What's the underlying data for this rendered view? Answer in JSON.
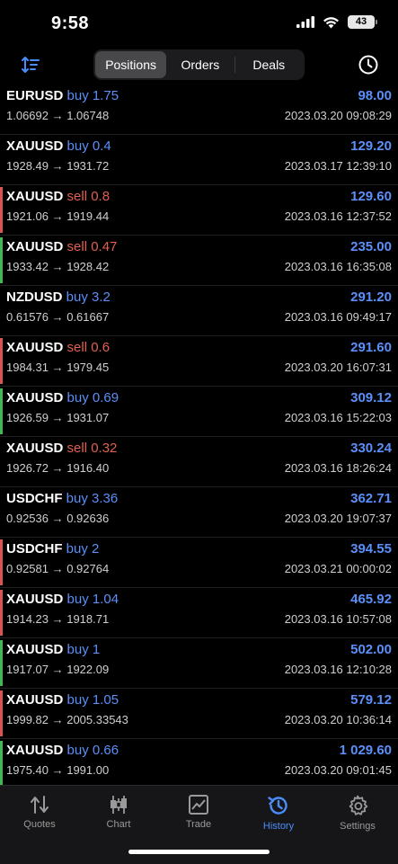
{
  "status": {
    "time": "9:58",
    "battery": "43"
  },
  "colors": {
    "accent": "#4b8df8",
    "buy": "#5b8ff9",
    "sell": "#e0614f",
    "green_marker": "#3fb950",
    "red_marker": "#d9534f"
  },
  "tabs_top": {
    "positions": "Positions",
    "orders": "Orders",
    "deals": "Deals",
    "active": "positions"
  },
  "deals": [
    {
      "symbol": "EURUSD",
      "side": "buy",
      "volume": "1.75",
      "prices": "1.06692 → 1.06748",
      "profit": "98.00",
      "time": "2023.03.20 09:08:29",
      "marker": "none"
    },
    {
      "symbol": "XAUUSD",
      "side": "buy",
      "volume": "0.4",
      "prices": "1928.49 → 1931.72",
      "profit": "129.20",
      "time": "2023.03.17 12:39:10",
      "marker": "none"
    },
    {
      "symbol": "XAUUSD",
      "side": "sell",
      "volume": "0.8",
      "prices": "1921.06 → 1919.44",
      "profit": "129.60",
      "time": "2023.03.16 12:37:52",
      "marker": "red"
    },
    {
      "symbol": "XAUUSD",
      "side": "sell",
      "volume": "0.47",
      "prices": "1933.42 → 1928.42",
      "profit": "235.00",
      "time": "2023.03.16 16:35:08",
      "marker": "green"
    },
    {
      "symbol": "NZDUSD",
      "side": "buy",
      "volume": "3.2",
      "prices": "0.61576 → 0.61667",
      "profit": "291.20",
      "time": "2023.03.16 09:49:17",
      "marker": "none"
    },
    {
      "symbol": "XAUUSD",
      "side": "sell",
      "volume": "0.6",
      "prices": "1984.31 → 1979.45",
      "profit": "291.60",
      "time": "2023.03.20 16:07:31",
      "marker": "red"
    },
    {
      "symbol": "XAUUSD",
      "side": "buy",
      "volume": "0.69",
      "prices": "1926.59 → 1931.07",
      "profit": "309.12",
      "time": "2023.03.16 15:22:03",
      "marker": "green"
    },
    {
      "symbol": "XAUUSD",
      "side": "sell",
      "volume": "0.32",
      "prices": "1926.72 → 1916.40",
      "profit": "330.24",
      "time": "2023.03.16 18:26:24",
      "marker": "none"
    },
    {
      "symbol": "USDCHF",
      "side": "buy",
      "volume": "3.36",
      "prices": "0.92536 → 0.92636",
      "profit": "362.71",
      "time": "2023.03.20 19:07:37",
      "marker": "none"
    },
    {
      "symbol": "USDCHF",
      "side": "buy",
      "volume": "2",
      "prices": "0.92581 → 0.92764",
      "profit": "394.55",
      "time": "2023.03.21 00:00:02",
      "marker": "red"
    },
    {
      "symbol": "XAUUSD",
      "side": "buy",
      "volume": "1.04",
      "prices": "1914.23 → 1918.71",
      "profit": "465.92",
      "time": "2023.03.16 10:57:08",
      "marker": "red"
    },
    {
      "symbol": "XAUUSD",
      "side": "buy",
      "volume": "1",
      "prices": "1917.07 → 1922.09",
      "profit": "502.00",
      "time": "2023.03.16 12:10:28",
      "marker": "green"
    },
    {
      "symbol": "XAUUSD",
      "side": "buy",
      "volume": "1.05",
      "prices": "1999.82 → 2005.33543",
      "profit": "579.12",
      "time": "2023.03.20 10:36:14",
      "marker": "red"
    },
    {
      "symbol": "XAUUSD",
      "side": "buy",
      "volume": "0.66",
      "prices": "1975.40 → 1991.00",
      "profit": "1 029.60",
      "time": "2023.03.20 09:01:45",
      "marker": "green"
    }
  ],
  "tabbar": [
    {
      "key": "quotes",
      "label": "Quotes",
      "icon": "quotes-arrows-icon"
    },
    {
      "key": "chart",
      "label": "Chart",
      "icon": "candlestick-icon"
    },
    {
      "key": "trade",
      "label": "Trade",
      "icon": "trade-chart-icon"
    },
    {
      "key": "history",
      "label": "History",
      "icon": "history-clock-icon",
      "active": true
    },
    {
      "key": "settings",
      "label": "Settings",
      "icon": "gear-icon"
    }
  ]
}
